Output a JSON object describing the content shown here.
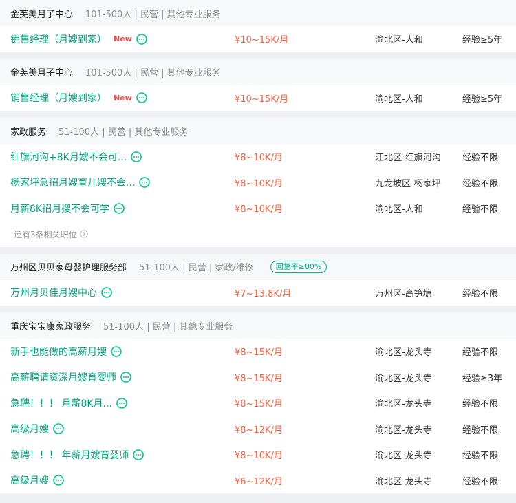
{
  "companies": [
    {
      "name": "金芙美月子中心",
      "meta": "101-500人 | 民营 | 其他专业服务",
      "jobs": [
        {
          "title": "销售经理（月嫂到家）",
          "new": "New",
          "salary": "¥10~15K/月",
          "location": "渝北区-人和",
          "experience": "经验≥5年"
        }
      ]
    },
    {
      "name": "金芙美月子中心",
      "meta": "101-500人 | 民营 | 其他专业服务",
      "jobs": [
        {
          "title": "销售经理（月嫂到家）",
          "new": "New",
          "salary": "¥10~15K/月",
          "location": "渝北区-人和",
          "experience": "经验≥5年"
        }
      ]
    },
    {
      "name": "家政服务",
      "meta": "51-100人 | 民营 | 其他专业服务",
      "jobs": [
        {
          "title": "红旗河沟+8K月嫂不会可...",
          "salary": "¥8~10K/月",
          "location": "江北区-红旗河沟",
          "experience": "经验不限"
        },
        {
          "title": "杨家坪急招月嫂育儿嫂不会...",
          "salary": "¥8~10K/月",
          "location": "九龙坡区-杨家坪",
          "experience": "经验不限"
        },
        {
          "title": "月薪8K招月搜不会可学",
          "salary": "¥8~10K/月",
          "location": "渝北区-人和",
          "experience": "经验不限"
        }
      ],
      "more": "还有3条相关职位"
    },
    {
      "name": "万州区贝贝家母婴护理服务部",
      "meta": "51-100人 | 民营 | 家政/维修",
      "badge": "回复率≥80%",
      "jobs": [
        {
          "title": "万州月贝佳月嫂中心",
          "salary": "¥7~13.8K/月",
          "location": "万州区-高笋塘",
          "experience": "经验不限"
        }
      ]
    },
    {
      "name": "重庆宝宝康家政服务",
      "meta": "51-100人 | 民营 | 其他专业服务",
      "jobs": [
        {
          "title": "新手也能做的高薪月嫂",
          "salary": "¥8~15K/月",
          "location": "渝北区-龙头寺",
          "experience": "经验不限"
        },
        {
          "title": "高薪聘请资深月嫂育婴师",
          "salary": "¥8~15K/月",
          "location": "渝北区-龙头寺",
          "experience": "经验≥3年"
        },
        {
          "title": "急聘！！！ 月薪8K月...",
          "salary": "¥8~15K/月",
          "location": "渝北区-龙头寺",
          "experience": "经验不限"
        },
        {
          "title": "高级月嫂",
          "salary": "¥8~12K/月",
          "location": "渝北区-龙头寺",
          "experience": "经验不限"
        },
        {
          "title": "急聘！！！ 年薪月嫂育婴师",
          "salary": "¥8~10K/月",
          "location": "渝北区-龙头寺",
          "experience": "经验不限"
        },
        {
          "title": "高级月嫂",
          "salary": "¥6~12K/月",
          "location": "渝北区-龙头寺",
          "experience": "经验不限"
        }
      ]
    }
  ],
  "icons": {
    "chat": "chat-bubble-icon",
    "info": "info-circle-icon"
  },
  "colors": {
    "accent": "#00a680",
    "salary": "#fa6041",
    "new": "#fb4a4a",
    "badge": "#00b38a"
  }
}
